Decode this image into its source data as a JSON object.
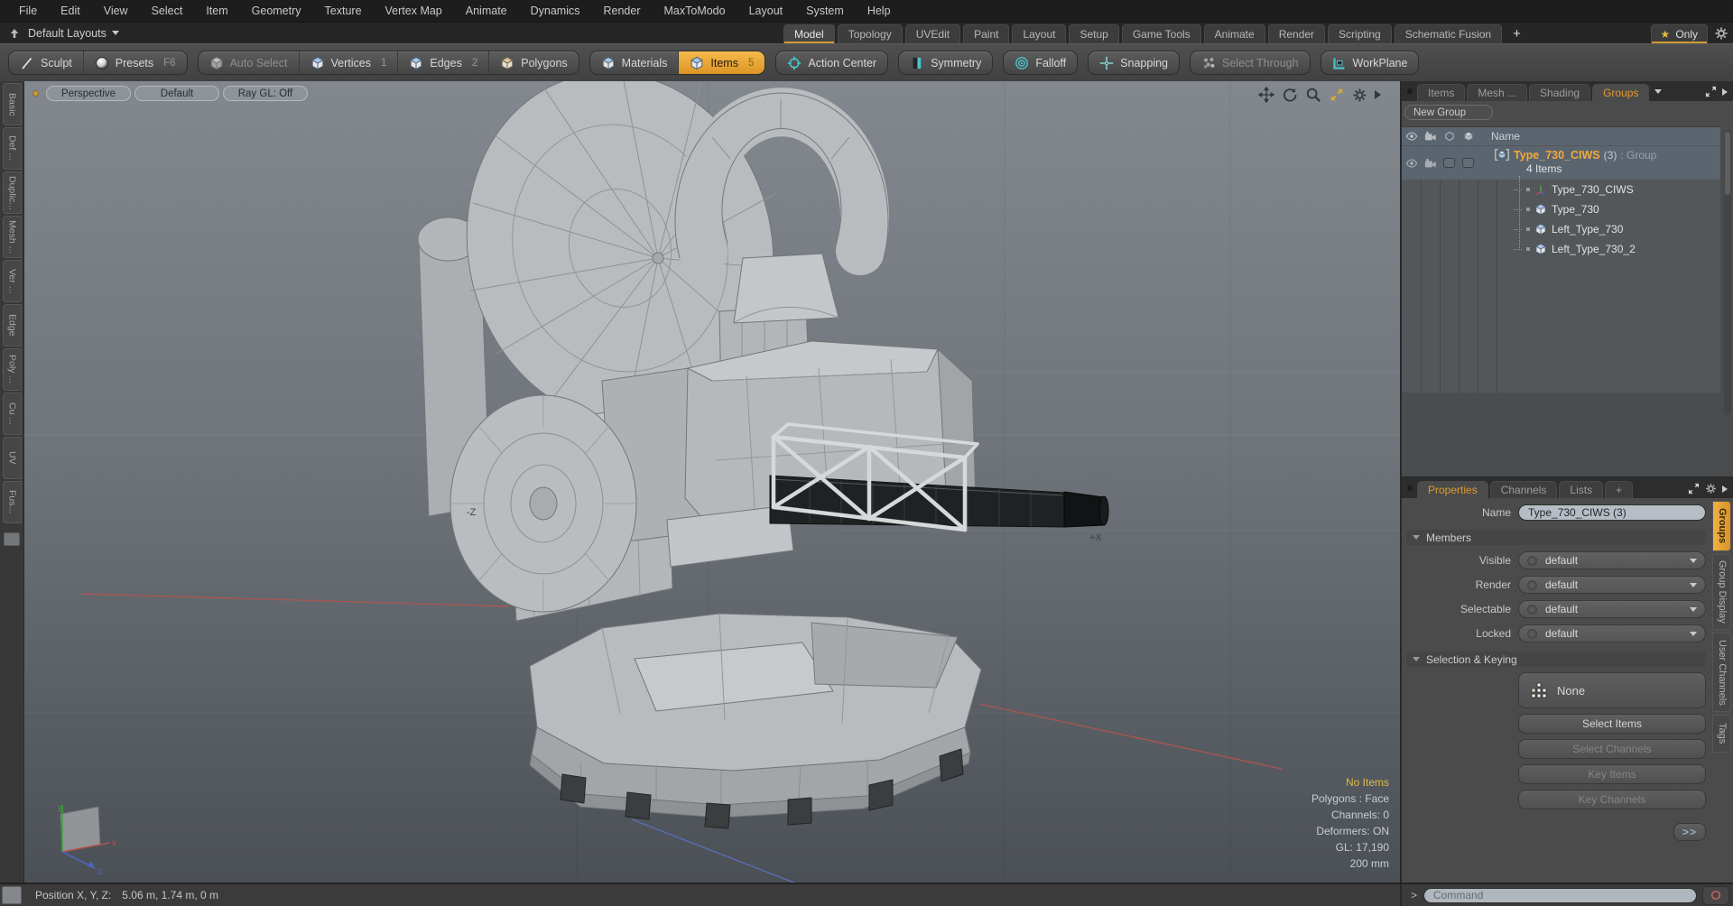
{
  "menu": {
    "items": [
      "File",
      "Edit",
      "View",
      "Select",
      "Item",
      "Geometry",
      "Texture",
      "Vertex Map",
      "Animate",
      "Dynamics",
      "Render",
      "MaxToModo",
      "Layout",
      "System",
      "Help"
    ]
  },
  "layout_bar": {
    "layouts_label": "Default Layouts",
    "tabs": [
      "Model",
      "Topology",
      "UVEdit",
      "Paint",
      "Layout",
      "Setup",
      "Game Tools",
      "Animate",
      "Render",
      "Scripting",
      "Schematic Fusion"
    ],
    "add_tab": "+",
    "star": "★",
    "only_label": "Only"
  },
  "toolbar": {
    "sculpt": "Sculpt",
    "presets": "Presets",
    "presets_key": "F6",
    "auto_select": "Auto Select",
    "vertices": "Vertices",
    "vertices_num": "1",
    "edges": "Edges",
    "edges_num": "2",
    "polygons": "Polygons",
    "materials": "Materials",
    "items": "Items",
    "items_num": "5",
    "action_center": "Action Center",
    "symmetry": "Symmetry",
    "falloff": "Falloff",
    "snapping": "Snapping",
    "select_through": "Select Through",
    "workplane": "WorkPlane"
  },
  "left_tabs": [
    "Basic",
    "Def ...",
    "Duplic...",
    "Mesh ...",
    "Ver ...",
    "Edge",
    "Poly ...",
    "Cu ...",
    "UV",
    "Fus..."
  ],
  "viewport": {
    "controls": {
      "camera": "Perspective",
      "shading": "Default",
      "raygl": "Ray GL: Off"
    },
    "axis_label_x": "+X",
    "axis_label_z": "-Z",
    "status": {
      "selection": "No Items",
      "polygons": "Polygons : Face",
      "channels": "Channels: 0",
      "deformers": "Deformers: ON",
      "gl": "GL: 17,190",
      "grid": "200 mm"
    },
    "gizmo": {
      "x": "x",
      "y": "y",
      "z": "z"
    }
  },
  "groups_panel": {
    "tabs": [
      "Items",
      "Mesh ...",
      "Shading",
      "Groups"
    ],
    "new_group_label": "New Group",
    "name_header": "Name",
    "root": {
      "name": "Type_730_CIWS",
      "count": "(3)",
      "type": ": Group",
      "summary": "4 Items"
    },
    "children": [
      "Type_730_CIWS",
      "Type_730",
      "Left_Type_730",
      "Left_Type_730_2"
    ]
  },
  "properties_panel": {
    "tabs": [
      "Properties",
      "Channels",
      "Lists",
      "+"
    ],
    "name_label": "Name",
    "name_value": "Type_730_CIWS (3)",
    "members_title": "Members",
    "rows": [
      {
        "label": "Visible",
        "value": "default"
      },
      {
        "label": "Render",
        "value": "default"
      },
      {
        "label": "Selectable",
        "value": "default"
      },
      {
        "label": "Locked",
        "value": "default"
      }
    ],
    "selection_title": "Selection & Keying",
    "none_label": "None",
    "select_items": "Select Items",
    "select_channels": "Select Channels",
    "key_items": "Key Items",
    "key_channels": "Key Channels",
    "more_label": ">>"
  },
  "side_tabs": [
    "Groups",
    "Group Display",
    "User Channels",
    "Tags"
  ],
  "status_bar": {
    "position_label": "Position X, Y, Z:",
    "position_value": "5.06 m, 1.74 m, 0 m",
    "prompt": ">",
    "command_placeholder": "Command"
  }
}
